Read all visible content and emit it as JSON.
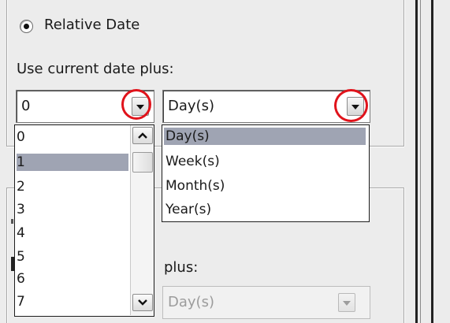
{
  "relative_date": {
    "radio_label": "Relative Date",
    "selected": true
  },
  "use_current_date_label": "Use current date plus:",
  "amount_combo": {
    "value": "0",
    "options": [
      "0",
      "1",
      "2",
      "3",
      "4",
      "5",
      "6",
      "7"
    ],
    "highlighted": "1"
  },
  "unit_combo": {
    "value": "Day(s)",
    "options": [
      "Day(s)",
      "Week(s)",
      "Month(s)",
      "Year(s)"
    ],
    "highlighted": "Day(s)"
  },
  "lower_section": {
    "plus_label": "plus:",
    "unit_value": "Day(s)"
  },
  "annotation_color": "#e0131b",
  "selection_color": "#9fa4b3"
}
